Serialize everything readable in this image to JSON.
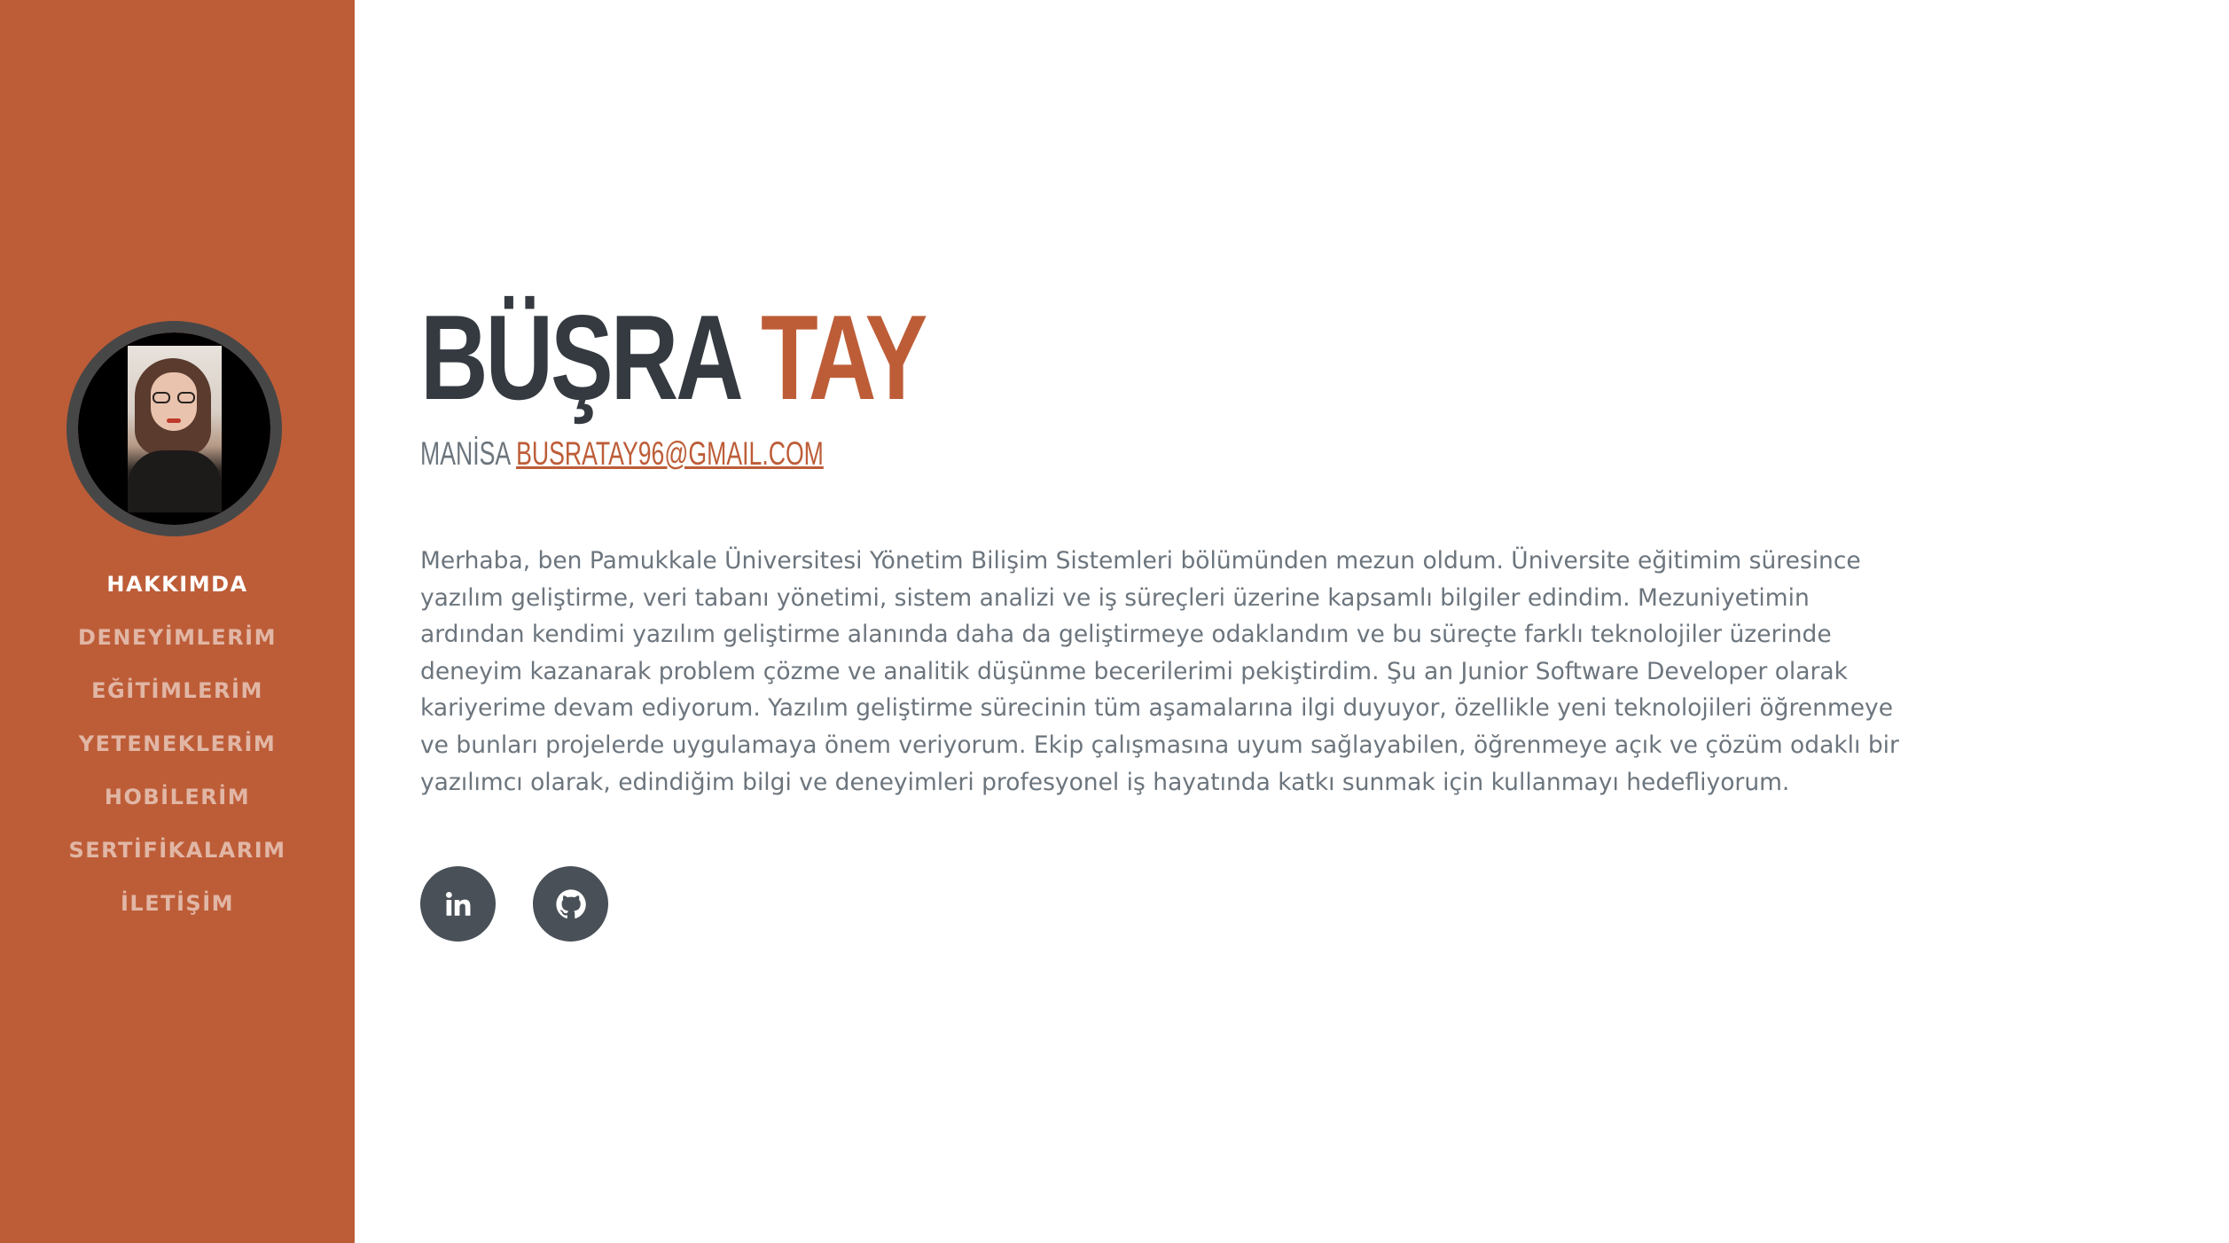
{
  "profile": {
    "first_name": "BÜŞRA",
    "last_name": "TAY",
    "location": "MANİSA",
    "email": "BUSRATAY96@GMAIL.COM"
  },
  "nav": {
    "items": [
      {
        "label": "HAKKIMDA",
        "active": true
      },
      {
        "label": "DENEYİMLERİM",
        "active": false
      },
      {
        "label": "EĞİTİMLERİM",
        "active": false
      },
      {
        "label": "YETENEKLERİM",
        "active": false
      },
      {
        "label": "HOBİLERİM",
        "active": false
      },
      {
        "label": "SERTİFİKALARIM",
        "active": false
      },
      {
        "label": "İLETİŞİM",
        "active": false
      }
    ]
  },
  "about": {
    "text": "Merhaba, ben Pamukkale Üniversitesi Yönetim Bilişim Sistemleri bölümünden mezun oldum. Üniversite eğitimim süresince yazılım geliştirme, veri tabanı yönetimi, sistem analizi ve iş süreçleri üzerine kapsamlı bilgiler edindim. Mezuniyetimin ardından kendimi yazılım geliştirme alanında daha da geliştirmeye odaklandım ve bu süreçte farklı teknolojiler üzerinde deneyim kazanarak problem çözme ve analitik düşünme becerilerimi pekiştirdim. Şu an Junior Software Developer olarak kariyerime devam ediyorum. Yazılım geliştirme sürecinin tüm aşamalarına ilgi duyuyor, özellikle yeni teknolojileri öğrenmeye ve bunları projelerde uygulamaya önem veriyorum. Ekip çalışmasına uyum sağlayabilen, öğrenmeye açık ve çözüm odaklı bir yazılımcı olarak, edindiğim bilgi ve deneyimleri profesyonel iş hayatında katkı sunmak için kullanmayı hedefliyorum."
  },
  "social": {
    "icons": [
      "linkedin-icon",
      "github-icon"
    ]
  },
  "colors": {
    "primary": "#bd5d38",
    "heading": "#343a40",
    "text": "#6c757d",
    "social_bg": "#495057"
  }
}
